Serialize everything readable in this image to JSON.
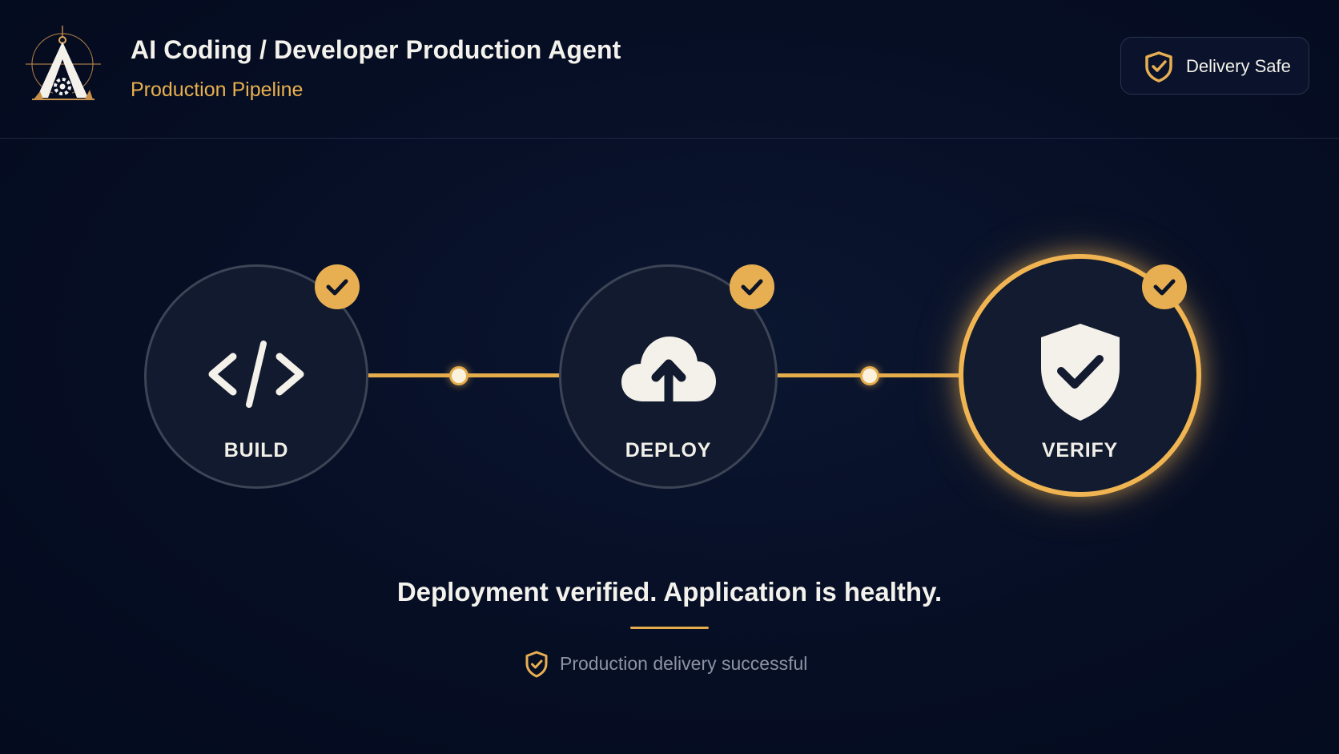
{
  "header": {
    "title": "AI Coding / Developer Production Agent",
    "subtitle": "Production Pipeline",
    "logo_icon": "compass-gear-logo-icon",
    "badge": {
      "label": "Delivery Safe",
      "icon": "shield-check-icon"
    }
  },
  "pipeline": {
    "stages": [
      {
        "label": "BUILD",
        "icon": "code-brackets-icon",
        "completed": true,
        "active": false
      },
      {
        "label": "DEPLOY",
        "icon": "cloud-upload-icon",
        "completed": true,
        "active": false
      },
      {
        "label": "VERIFY",
        "icon": "shield-check-icon",
        "completed": true,
        "active": true
      }
    ],
    "connector_count": 2
  },
  "status": {
    "message": "Deployment verified. Application is healthy.",
    "sub_text": "Production delivery successful",
    "sub_icon": "shield-check-icon"
  },
  "colors": {
    "background": "#050d22",
    "accent": "#e7af52",
    "text": "#f4f2ec",
    "muted_text": "#8d93a3"
  }
}
